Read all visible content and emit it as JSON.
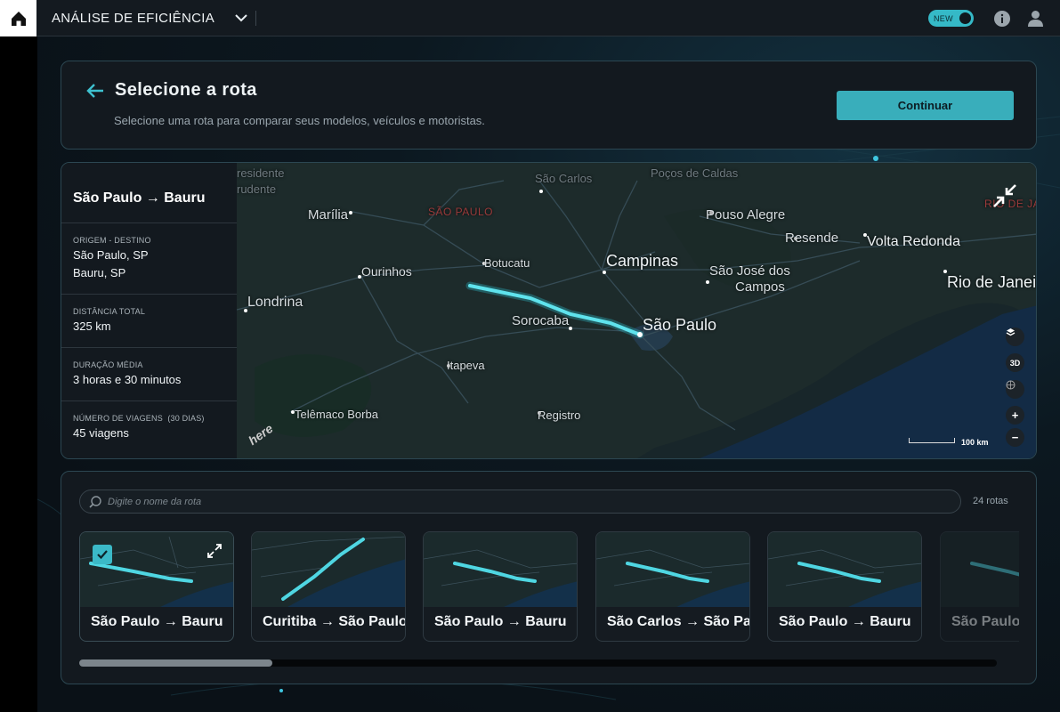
{
  "topbar": {
    "app_title": "ANÁLISE DE EFICIÊNCIA",
    "new_toggle_label": "NEW",
    "icons": [
      "home-icon",
      "chevron-down-icon",
      "info-icon",
      "user-icon"
    ]
  },
  "header": {
    "title": "Selecione a rota",
    "subtitle": "Selecione uma rota para comparar seus modelos, veículos e motoristas.",
    "continue_label": "Continuar"
  },
  "route_detail": {
    "name": "São Paulo → Bauru",
    "rows": [
      {
        "label": "Origem - Destino",
        "values": [
          "São Paulo, SP",
          "Bauru, SP"
        ]
      },
      {
        "label": "Distância total",
        "values": [
          "325 km"
        ]
      },
      {
        "label": "Duração média",
        "values": [
          "3 horas e 30 minutos"
        ]
      },
      {
        "label": "Número de viagens  (30 dias)",
        "values": [
          "45 viagens"
        ]
      }
    ]
  },
  "map": {
    "labels": {
      "presidente": "residente",
      "prudente": "rudente",
      "sao_carlos": "São Carlos",
      "pocos": "Poços de Caldas",
      "estado_sp": "SÃO PAULO",
      "estado_rj": "RIO DE JANEIRO",
      "marilia": "Marília",
      "pouso": "Pouso Alegre",
      "resende": "Resende",
      "volta": "Volta Redonda",
      "botucatu": "Botucatu",
      "campinas": "Campinas",
      "ourinhos": "Ourinhos",
      "sjc1": "São José dos",
      "sjc2": "Campos",
      "rio": "Rio de Janeiro",
      "londrina": "Londrina",
      "sorocaba": "Sorocaba",
      "saopaulo": "São Paulo",
      "itapeva": "Itapeva",
      "telemaco": "Telêmaco Borba",
      "registro": "Registro"
    },
    "scale_label": "100 km",
    "controls": [
      "layers-icon",
      "3D",
      "globe-icon",
      "+",
      "−"
    ],
    "route_color": "#3fd0dc",
    "logo_text": "here"
  },
  "list": {
    "search_placeholder": "Digite o nome da rota",
    "count_label": "24 rotas",
    "cards": [
      {
        "title": "São Paulo → Bauru",
        "selected": true
      },
      {
        "title": "Curitiba → São Paulo",
        "selected": false
      },
      {
        "title": "São Paulo → Bauru",
        "selected": false
      },
      {
        "title": "São Carlos → São Paulo",
        "selected": false
      },
      {
        "title": "São Paulo → Bauru",
        "selected": false
      },
      {
        "title": "São Paulo → Bauru",
        "selected": false
      }
    ],
    "scroll_position": 0.21
  },
  "colors": {
    "accent": "#39aebb",
    "panel": "#13191f",
    "border": "#2c4752"
  }
}
